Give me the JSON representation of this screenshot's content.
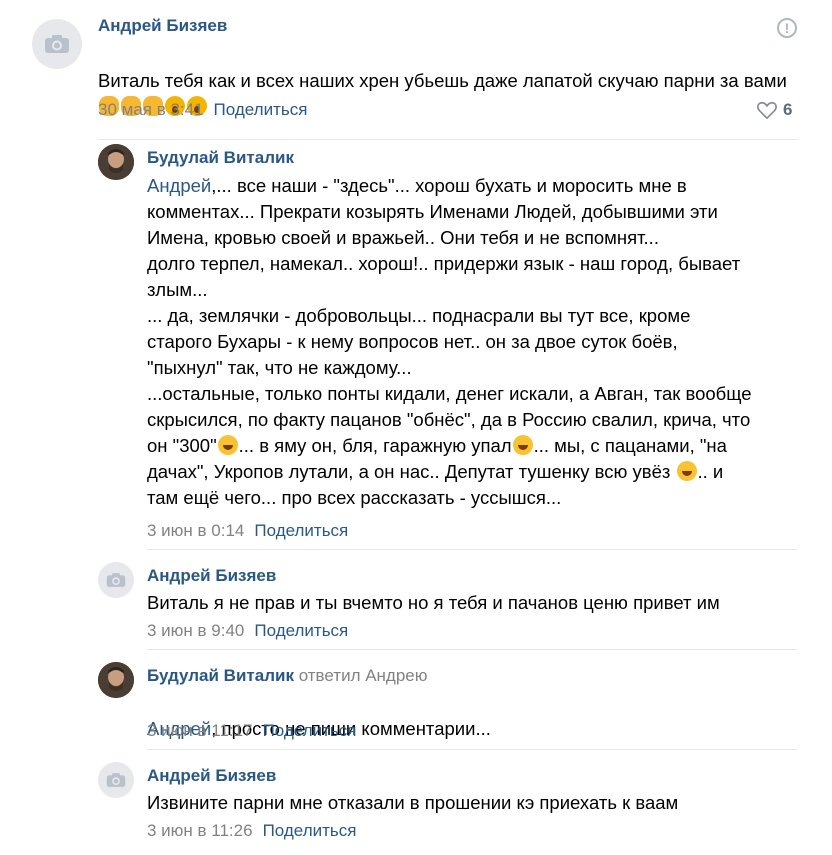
{
  "comments": [
    {
      "author": "Андрей Бизяев",
      "reply_to": "",
      "mention": "",
      "text": "Виталь тебя как и всех наших хрен убьешь даже лапатой скучаю парни за вами",
      "emojis": [
        "fist",
        "fist",
        "fist",
        "scream",
        "scream"
      ],
      "date": "30 мая в 3:41",
      "share": "Поделиться",
      "likes": "6",
      "avatar": "camera-placeholder"
    },
    {
      "author": "Будулай Виталик",
      "reply_to": "",
      "mention": "Андрей",
      "text_lines": [
        ",... все наши - \"здесь\"... хорош бухать и моросить мне в",
        "комментах... Прекрати козырять Именами Людей, добывшими эти",
        "Имена, кровью своей и вражьей.. Они тебя и не вспомнят...",
        "долго терпел, намекал.. хорош!.. придержи язык - наш город, бывает",
        "злым...",
        "... да, землячки - добровольцы... поднасрали вы тут все, кроме",
        "старого Бухары - к нему вопросов нет.. он за двое суток боёв,",
        "\"пыхнул\" так, что не каждому...",
        "...остальные, только понты кидали, денег искали, а Авган, так вообще",
        "скрысился, по факту пацанов \"обнёс\", да в Россию свалил, крича, что"
      ],
      "text_tail": [
        "он \"300\"",
        "... в яму он, бля, гаражную упал",
        "... мы, с пацанами, \"на",
        "дачах\", Укропов лутали, а он нас.. Депутат тушенку всю увёз ",
        ".. и",
        "там ещё чего... про всех рассказать - уссышся..."
      ],
      "date": "3 июн в 0:14",
      "share": "Поделиться",
      "avatar": "user-photo"
    },
    {
      "author": "Андрей Бизяев",
      "reply_to": "",
      "mention": "",
      "text": "Виталь я не прав и ты вчемто но я тебя и пачанов ценю привет им",
      "date": "3 июн в 9:40",
      "share": "Поделиться",
      "avatar": "camera-placeholder"
    },
    {
      "author": "Будулай Виталик",
      "reply_to": "ответил Андрею",
      "mention": "Андрей",
      "text": ", просто не пиши комментарии...",
      "date": "3 июн в 11:17",
      "share": "Поделиться",
      "avatar": "user-photo"
    },
    {
      "author": "Андрей Бизяев",
      "reply_to": "",
      "mention": "",
      "text": "Извините парни мне отказали в прошении кэ приехать к ваам",
      "date": "3 июн в 11:26",
      "share": "Поделиться",
      "avatar": "camera-placeholder"
    }
  ],
  "colors": {
    "link": "#2a5885",
    "meta": "#828282",
    "divider": "#e7e8ec",
    "placeholder_bg": "#e7e8ec"
  }
}
